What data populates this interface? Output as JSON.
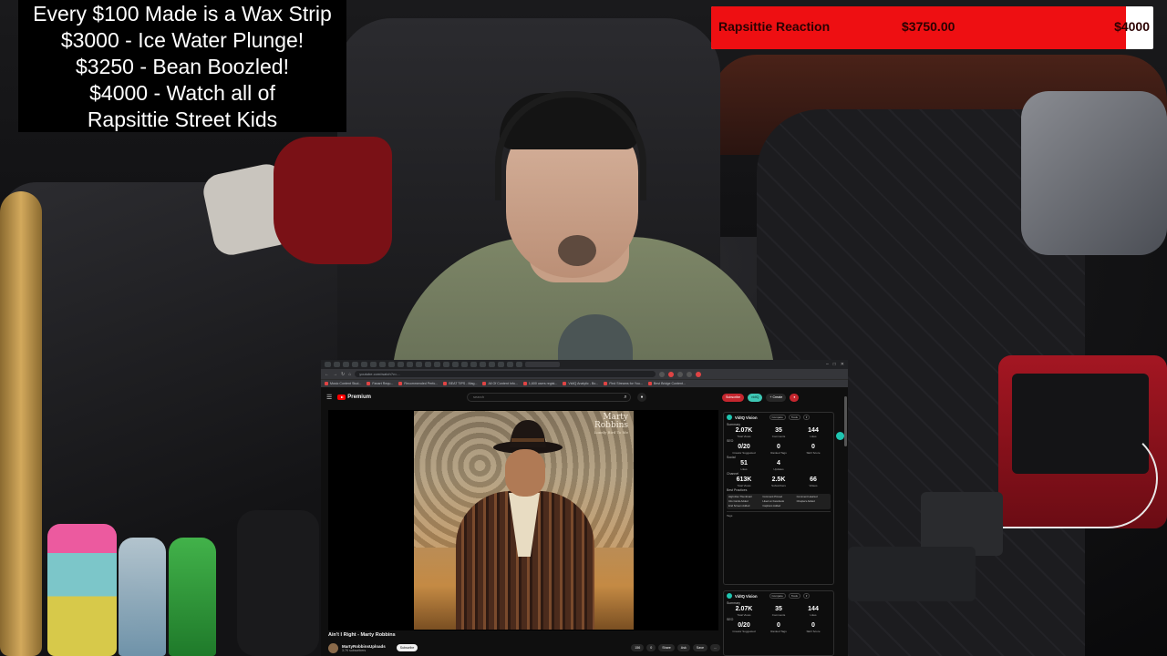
{
  "stream_overlay": {
    "goals": [
      "Every $100 Made is a Wax Strip",
      "$3000 - Ice Water Plunge!",
      "$3250 - Bean Boozled!",
      "$4000 - Watch all of",
      "Rapsittie Street Kids"
    ],
    "progress": {
      "name": "Rapsittie Reaction",
      "amount": "$3750.00",
      "goal": "$4000",
      "fraction": 0.9375,
      "fill_color": "#ee0f12"
    }
  },
  "browser": {
    "url": "youtube.com/watch?v=...",
    "bookmarks": [
      "Music Content Stud...",
      "Fanart Requ...",
      "Recommended Perfo...",
      "BEAT TIPS - Mag...",
      "All Of Content Info...",
      "1,600 users regist...",
      "VidIQ Analytic - Bo...",
      "Find Streams for You...",
      "Best Bridge Content..."
    ]
  },
  "youtube": {
    "logo": "Premium",
    "search_placeholder": "search",
    "header_buttons": [
      "Subscribe",
      "vidIQ",
      "+ Create"
    ],
    "video_title": "Ain't I Right - Marty Robbins",
    "channel_name": "MartyRobbinsUploads",
    "channel_subs": "3.7K subscribers",
    "subscribe_label": "Subscribe",
    "actions": [
      "156",
      "0",
      "Share",
      "Ask",
      "Save",
      "..."
    ],
    "album": {
      "title_line1": "Marty",
      "title_line2": "Robbins",
      "subtitle": "Lonely Bird To Me"
    }
  },
  "vidiq": {
    "name": "VidIQ Vision",
    "controls": [
      "Compare",
      "Tools"
    ],
    "summary_label": "Summary",
    "summary": [
      {
        "value": "2.07K",
        "label": "Total Views"
      },
      {
        "value": "35",
        "label": "Comments"
      },
      {
        "value": "144",
        "label": "Likes"
      }
    ],
    "seo_label": "SEO",
    "seo": [
      {
        "value": "0/20",
        "label": "Creator Suggested"
      },
      {
        "value": "0",
        "label": "Ranked Tags"
      },
      {
        "value": "0",
        "label": "SEO Score"
      }
    ],
    "social_label": "Social",
    "social": [
      {
        "value": "51",
        "label": "Likes"
      },
      {
        "value": "4",
        "label": "Updates"
      }
    ],
    "channel_label": "Channel",
    "channel": [
      {
        "value": "613K",
        "label": "Total Views"
      },
      {
        "value": "2.5K",
        "label": "Subscribers"
      },
      {
        "value": "66",
        "label": "Videos"
      }
    ],
    "best_practices_label": "Best Practices",
    "best_practices": [
      "High-Res Thumbnail",
      "Comment Pinned",
      "Comment Hearted",
      "Info Cards Added",
      "Liked on Facebook",
      "Chapters Added",
      "End Screen Added",
      "Captions Added",
      ""
    ],
    "tags_label": "Tags"
  }
}
